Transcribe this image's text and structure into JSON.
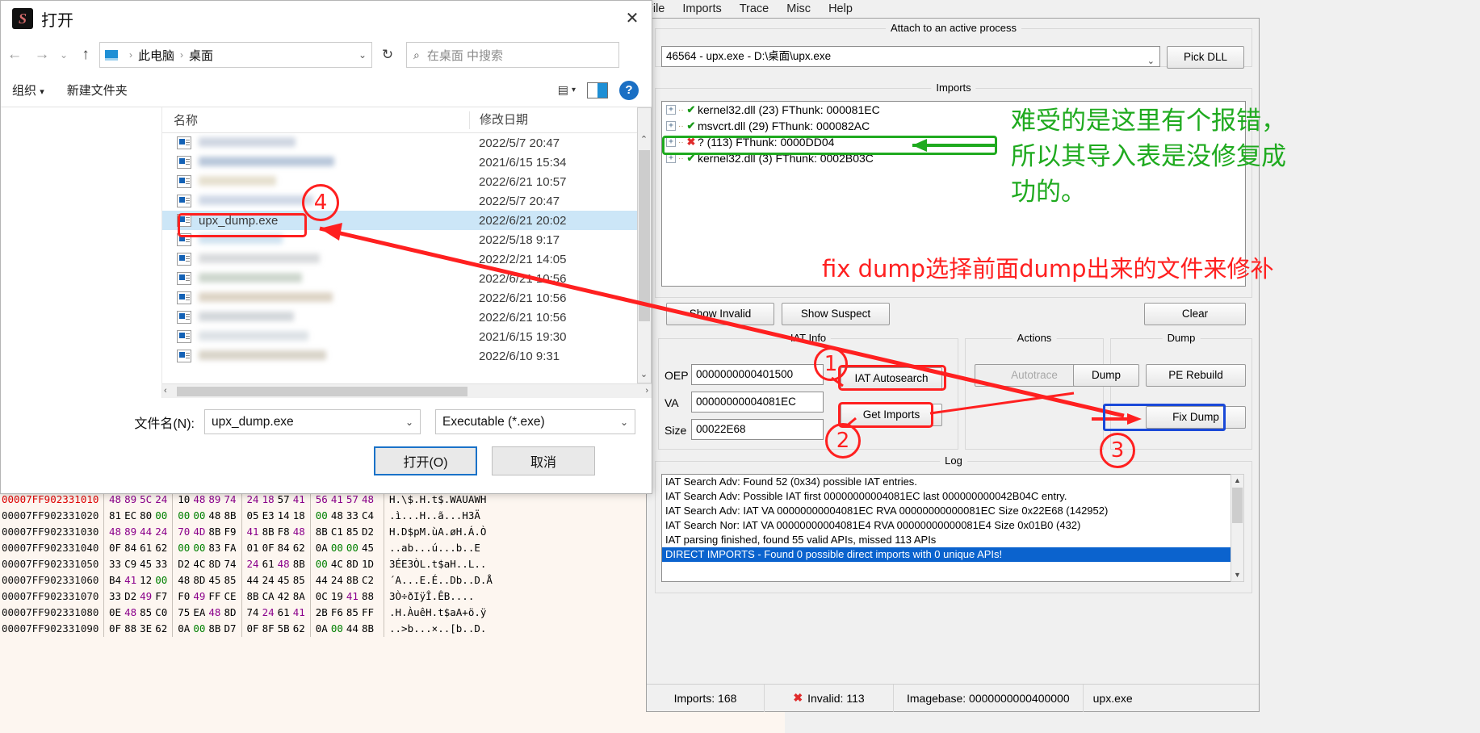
{
  "app": {
    "menubar": [
      "File",
      "Imports",
      "Trace",
      "Misc",
      "Help"
    ],
    "attach": {
      "group_title": "Attach to an active process",
      "process_value": "46564 - upx.exe - D:\\桌面\\upx.exe",
      "pick_dll_label": "Pick DLL"
    },
    "imports": {
      "group_title": "Imports",
      "tree": [
        {
          "expander": "+",
          "status": "check",
          "label": "kernel32.dll (23) FThunk: 000081EC"
        },
        {
          "expander": "+",
          "status": "check",
          "label": "msvcrt.dll (29) FThunk: 000082AC"
        },
        {
          "expander": "+",
          "status": "cross",
          "label": "? (113) FThunk: 0000DD04"
        },
        {
          "expander": "+",
          "status": "check",
          "label": "kernel32.dll (3) FThunk: 0002B03C"
        }
      ],
      "show_invalid_label": "Show Invalid",
      "show_suspect_label": "Show Suspect",
      "clear_label": "Clear"
    },
    "iat_info": {
      "group_title": "IAT Info",
      "oep_label": "OEP",
      "oep_value": "0000000000401500",
      "va_label": "VA",
      "va_value": "00000000004081EC",
      "size_label": "Size",
      "size_value": "00022E68",
      "iat_autosearch_label": "IAT Autosearch",
      "get_imports_label": "Get Imports"
    },
    "actions": {
      "group_title": "Actions",
      "autotrace_label": "Autotrace"
    },
    "dump": {
      "group_title": "Dump",
      "dump_label": "Dump",
      "pe_rebuild_label": "PE Rebuild",
      "fix_dump_label": "Fix Dump"
    },
    "log": {
      "group_title": "Log",
      "lines": [
        "IAT Search Adv: Found 52 (0x34) possible IAT entries.",
        "IAT Search Adv: Possible IAT first 00000000004081EC last 000000000042B04C entry.",
        "IAT Search Adv: IAT VA 00000000004081EC RVA 00000000000081EC Size 0x22E68 (142952)",
        "IAT Search Nor: IAT VA 00000000004081E4 RVA 00000000000081E4 Size 0x01B0 (432)",
        "IAT parsing finished, found 55 valid APIs, missed 113 APIs",
        "DIRECT IMPORTS - Found 0 possible direct imports with 0 unique APIs!"
      ],
      "selected_index": 5
    },
    "statusbar": {
      "imports": "Imports: 168",
      "invalid": "Invalid: 113",
      "imagebase": "Imagebase: 0000000000400000",
      "filename": "upx.exe"
    }
  },
  "dialog": {
    "title": "打开",
    "close_label": "✕",
    "nav": {
      "back": "←",
      "forward": "→",
      "recent": "⌄",
      "up": "↑",
      "breadcrumb": [
        "此电脑",
        "桌面"
      ],
      "refresh": "↻",
      "search_placeholder": "在桌面 中搜索"
    },
    "toolbar": {
      "organize": "组织",
      "new_folder": "新建文件夹",
      "help": "?"
    },
    "columns": {
      "name": "名称",
      "date": "修改日期"
    },
    "rows": [
      {
        "name": "",
        "blurred": true,
        "date": "2022/5/7 20:47",
        "selected": false
      },
      {
        "name": "",
        "blurred": true,
        "date": "2021/6/15 15:34",
        "selected": false
      },
      {
        "name": "",
        "blurred": true,
        "date": "2022/6/21 10:57",
        "selected": false
      },
      {
        "name": "",
        "blurred": true,
        "date": "2022/5/7 20:47",
        "selected": false
      },
      {
        "name": "upx_dump.exe",
        "blurred": false,
        "date": "2022/6/21 20:02",
        "selected": true
      },
      {
        "name": "",
        "blurred": true,
        "date": "2022/5/18 9:17",
        "selected": false
      },
      {
        "name": "",
        "blurred": true,
        "date": "2022/2/21 14:05",
        "selected": false
      },
      {
        "name": "",
        "blurred": true,
        "date": "2022/6/21 10:56",
        "selected": false
      },
      {
        "name": "",
        "blurred": true,
        "date": "2022/6/21 10:56",
        "selected": false
      },
      {
        "name": "",
        "blurred": true,
        "date": "2022/6/21 10:56",
        "selected": false
      },
      {
        "name": "",
        "blurred": true,
        "date": "2021/6/15 19:30",
        "selected": false
      },
      {
        "name": "",
        "blurred": true,
        "date": "2022/6/10 9:31",
        "selected": false
      }
    ],
    "footer": {
      "filename_label": "文件名(N):",
      "filename_value": "upx_dump.exe",
      "filetype_value": "Executable (*.exe)",
      "open_label": "打开(O)",
      "cancel_label": "取消"
    }
  },
  "hexdump": {
    "rows": [
      {
        "addr": "00007FF902331010",
        "first": true,
        "groups": [
          [
            "48",
            "89",
            "5C",
            "24"
          ],
          [
            "10",
            "48",
            "89",
            "74"
          ],
          [
            "24",
            "18",
            "57",
            "41"
          ],
          [
            "56",
            "41",
            "57",
            "48"
          ]
        ],
        "colors": [
          [
            "p",
            "p",
            "p",
            "p"
          ],
          [
            "k",
            "p",
            "p",
            "p"
          ],
          [
            "p",
            "p",
            "k",
            "p"
          ],
          [
            "p",
            "p",
            "p",
            "p"
          ]
        ],
        "ascii": "H.\\$.H.t$.WAUAWH"
      },
      {
        "addr": "00007FF902331020",
        "first": false,
        "groups": [
          [
            "81",
            "EC",
            "80",
            "00"
          ],
          [
            "00",
            "00",
            "48",
            "8B"
          ],
          [
            "05",
            "E3",
            "14",
            "18"
          ],
          [
            "00",
            "48",
            "33",
            "C4"
          ]
        ],
        "colors": [
          [
            "k",
            "k",
            "k",
            "g"
          ],
          [
            "g",
            "g",
            "k",
            "k"
          ],
          [
            "k",
            "k",
            "k",
            "k"
          ],
          [
            "g",
            "k",
            "k",
            "k"
          ]
        ],
        "ascii": ".ì...H..ã...H3Ä"
      },
      {
        "addr": "00007FF902331030",
        "first": false,
        "groups": [
          [
            "48",
            "89",
            "44",
            "24"
          ],
          [
            "70",
            "4D",
            "8B",
            "F9"
          ],
          [
            "41",
            "8B",
            "F8",
            "48"
          ],
          [
            "8B",
            "C1",
            "85",
            "D2"
          ]
        ],
        "colors": [
          [
            "p",
            "p",
            "p",
            "p"
          ],
          [
            "p",
            "p",
            "k",
            "k"
          ],
          [
            "p",
            "k",
            "k",
            "p"
          ],
          [
            "k",
            "k",
            "k",
            "k"
          ]
        ],
        "ascii": "H.D$pM.ùA.øH.Á.Ò"
      },
      {
        "addr": "00007FF902331040",
        "first": false,
        "groups": [
          [
            "0F",
            "84",
            "61",
            "62"
          ],
          [
            "00",
            "00",
            "83",
            "FA"
          ],
          [
            "01",
            "0F",
            "84",
            "62"
          ],
          [
            "0A",
            "00",
            "00",
            "45"
          ]
        ],
        "colors": [
          [
            "k",
            "k",
            "k",
            "k"
          ],
          [
            "g",
            "g",
            "k",
            "k"
          ],
          [
            "k",
            "k",
            "k",
            "k"
          ],
          [
            "k",
            "g",
            "g",
            "k"
          ]
        ],
        "ascii": "..ab...ú...b..E"
      },
      {
        "addr": "00007FF902331050",
        "first": false,
        "groups": [
          [
            "33",
            "C9",
            "45",
            "33"
          ],
          [
            "D2",
            "4C",
            "8D",
            "74"
          ],
          [
            "24",
            "61",
            "48",
            "8B"
          ],
          [
            "00",
            "4C",
            "8D",
            "1D"
          ]
        ],
        "colors": [
          [
            "k",
            "k",
            "k",
            "k"
          ],
          [
            "k",
            "k",
            "k",
            "k"
          ],
          [
            "p",
            "k",
            "p",
            "k"
          ],
          [
            "g",
            "k",
            "k",
            "k"
          ]
        ],
        "ascii": "3ÉE3ÒL.t$aH..L.."
      },
      {
        "addr": "00007FF902331060",
        "first": false,
        "groups": [
          [
            "B4",
            "41",
            "12",
            "00"
          ],
          [
            "48",
            "8D",
            "45",
            "85"
          ],
          [
            "44",
            "24",
            "45",
            "85"
          ],
          [
            "44",
            "24",
            "8B",
            "C2"
          ]
        ],
        "colors": [
          [
            "k",
            "p",
            "k",
            "g"
          ],
          [
            "k",
            "k",
            "k",
            "k"
          ],
          [
            "k",
            "k",
            "k",
            "k"
          ],
          [
            "k",
            "k",
            "k",
            "k"
          ]
        ],
        "ascii": "´A...E.É..Db..D.Å"
      },
      {
        "addr": "00007FF902331070",
        "first": false,
        "groups": [
          [
            "33",
            "D2",
            "49",
            "F7"
          ],
          [
            "F0",
            "49",
            "FF",
            "CE"
          ],
          [
            "8B",
            "CA",
            "42",
            "8A"
          ],
          [
            "0C",
            "19",
            "41",
            "88"
          ]
        ],
        "colors": [
          [
            "k",
            "k",
            "p",
            "k"
          ],
          [
            "k",
            "p",
            "k",
            "k"
          ],
          [
            "k",
            "k",
            "k",
            "k"
          ],
          [
            "k",
            "k",
            "p",
            "k"
          ]
        ],
        "ascii": "3Ò÷ðIÿÎ.ÊB...."
      },
      {
        "addr": "00007FF902331080",
        "first": false,
        "groups": [
          [
            "0E",
            "48",
            "85",
            "C0"
          ],
          [
            "75",
            "EA",
            "48",
            "8D"
          ],
          [
            "74",
            "24",
            "61",
            "41"
          ],
          [
            "2B",
            "F6",
            "85",
            "FF"
          ]
        ],
        "colors": [
          [
            "k",
            "p",
            "k",
            "k"
          ],
          [
            "k",
            "k",
            "p",
            "k"
          ],
          [
            "k",
            "p",
            "k",
            "p"
          ],
          [
            "k",
            "k",
            "k",
            "k"
          ]
        ],
        "ascii": ".H.ÀuêH.t$aA+ö.ÿ"
      },
      {
        "addr": "00007FF902331090",
        "first": false,
        "groups": [
          [
            "0F",
            "88",
            "3E",
            "62"
          ],
          [
            "0A",
            "00",
            "8B",
            "D7"
          ],
          [
            "0F",
            "8F",
            "5B",
            "62"
          ],
          [
            "0A",
            "00",
            "44",
            "8B"
          ]
        ],
        "colors": [
          [
            "k",
            "k",
            "k",
            "k"
          ],
          [
            "k",
            "g",
            "k",
            "k"
          ],
          [
            "k",
            "k",
            "k",
            "k"
          ],
          [
            "k",
            "g",
            "k",
            "k"
          ]
        ],
        "ascii": "..>b...×..[b..D."
      }
    ]
  },
  "annotations": {
    "green_note_lines": [
      "难受的是这里有个报错，",
      "所以其导入表是没修复成",
      "功的。"
    ],
    "red_note": "fix dump选择前面dump出来的文件来修补",
    "markers": [
      "1",
      "2",
      "3",
      "4"
    ]
  }
}
